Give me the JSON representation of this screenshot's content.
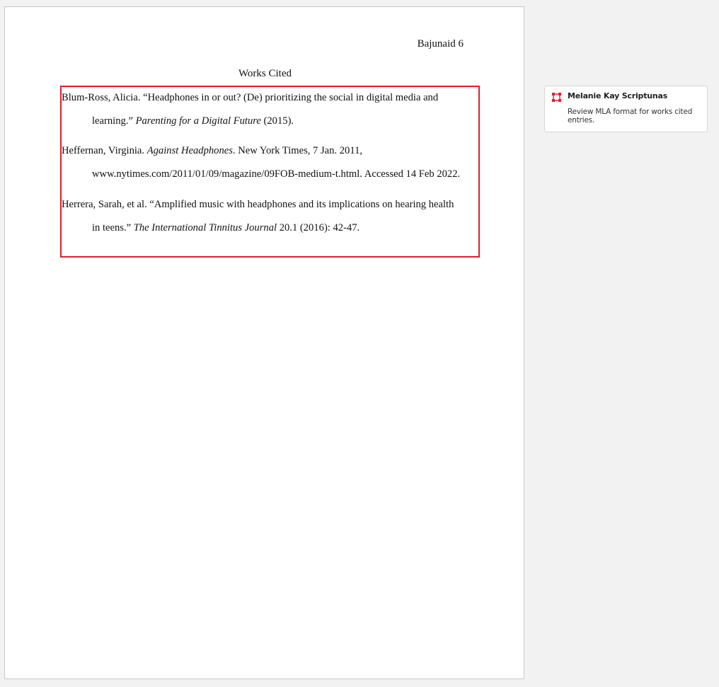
{
  "document": {
    "running_head": "Bajunaid 6",
    "section_title": "Works Cited",
    "entries": [
      {
        "line1": "Blum-Ross, Alicia. “Headphones in or out? (De) prioritizing the social in digital media and",
        "line2_pre": "learning.” ",
        "line2_italic": "Parenting for a Digital Future",
        "line2_post": " (2015)."
      },
      {
        "line1_pre": "Heffernan, Virginia. ",
        "line1_italic": "Against Headphones",
        "line1_post": ". New York Times, 7 Jan. 2011,",
        "line2": "www.nytimes.com/2011/01/09/magazine/09FOB-medium-t.html. Accessed 14 Feb 2022."
      },
      {
        "line1": "Herrera, Sarah, et al. “Amplified music with headphones and its implications on hearing health",
        "line2_pre": "in teens.” ",
        "line2_italic": "The International Tinnitus Journal",
        "line2_post": " 20.1 (2016): 42-47."
      }
    ]
  },
  "comment": {
    "icon": "area-annotation-icon",
    "author": "Melanie Kay Scriptunas",
    "text": "Review MLA format for works cited entries."
  },
  "colors": {
    "annotation": "#e0202f",
    "page_background": "#ffffff",
    "workspace_background": "#f2f2f2"
  }
}
